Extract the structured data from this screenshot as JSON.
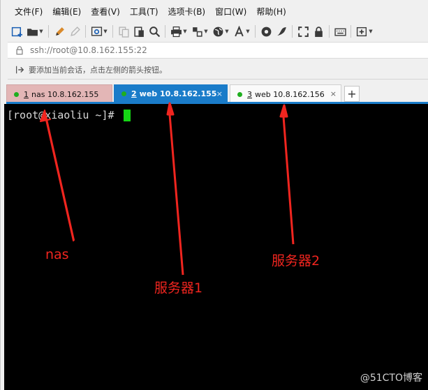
{
  "menu": [
    "文件(F)",
    "编辑(E)",
    "查看(V)",
    "工具(T)",
    "选项卡(B)",
    "窗口(W)",
    "帮助(H)"
  ],
  "address": {
    "text": "ssh://root@10.8.162.155:22"
  },
  "hint": {
    "text": "要添加当前会话，点击左侧的箭头按钮。"
  },
  "tabs": [
    {
      "num": "1",
      "label": "nas 10.8.162.155",
      "state": "inactive",
      "color": "#e3b6b6"
    },
    {
      "num": "2",
      "label": "web 10.8.162.155",
      "state": "active",
      "color": "#1a7cc9"
    },
    {
      "num": "3",
      "label": "web 10.8.162.156",
      "state": "inactive",
      "color": "#fafafa"
    }
  ],
  "tab_close": "×",
  "tab_add": "+",
  "terminal": {
    "prompt": "[root@xiaoliu ~]# "
  },
  "annotations": {
    "nas": "nas",
    "server1": "服务器1",
    "server2": "服务器2",
    "color": "#f0251f"
  },
  "watermark": "@51CTO博客",
  "icons": [
    "new-session-icon",
    "open-folder-icon",
    "pencil-icon",
    "eraser-icon",
    "gear-icon",
    "copy-icon",
    "paste-icon",
    "search-icon",
    "print-icon",
    "transfer-icon",
    "globe-icon",
    "font-icon",
    "record-icon",
    "script-icon",
    "fullscreen-icon",
    "lock-icon",
    "keyboard-icon",
    "new-tab-icon"
  ]
}
